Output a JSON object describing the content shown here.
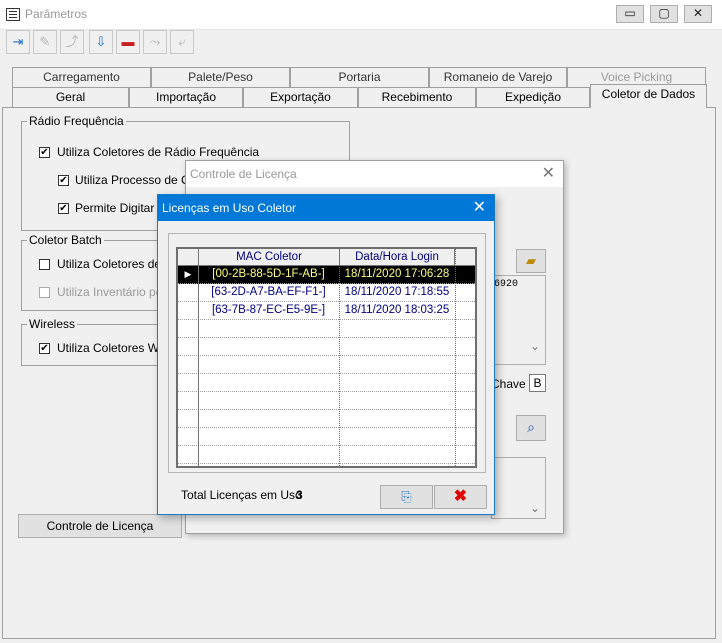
{
  "window": {
    "title": "Parâmetros",
    "controls": {
      "minimize": "▭",
      "maximize": "▢",
      "close": "✕"
    }
  },
  "toolbar": {
    "buttons": [
      {
        "icon": "exit-icon",
        "glyph": "⇥"
      },
      {
        "icon": "edit-icon",
        "glyph": "✎"
      },
      {
        "icon": "new-record-icon",
        "glyph": "⤴"
      },
      {
        "icon": "save-icon",
        "glyph": "⇩"
      },
      {
        "icon": "cancel-icon",
        "glyph": "▬"
      },
      {
        "icon": "copy-icon",
        "glyph": "⤳"
      },
      {
        "icon": "paste-icon",
        "glyph": "⤶"
      }
    ]
  },
  "tabs": {
    "back_row": [
      "Carregamento",
      "Palete/Peso",
      "Portaria",
      "Romaneio de Varejo",
      "Voice Picking"
    ],
    "front_row": [
      "Geral",
      "Importação",
      "Exportação",
      "Recebimento",
      "Expedição",
      "Coletor de Dados"
    ],
    "active": "Coletor de Dados"
  },
  "radio_freq": {
    "title": "Rádio Frequência",
    "opt1": "Utiliza Coletores de Rádio Frequência",
    "opt2": "Utiliza Processo de Con",
    "opt3": "Permite Digitar Có"
  },
  "batch": {
    "title": "Coletor Batch",
    "opt1": "Utiliza Coletores de D",
    "opt2": "Utiliza Inventário pelo"
  },
  "wireless": {
    "title": "Wireless",
    "opt1": "Utiliza Coletores Wire"
  },
  "license_button": "Controle de Licença",
  "license_dialog": {
    "title": "Controle de Licença",
    "key_fragment": "6920",
    "chave_label": "Chave",
    "chave_value": "B"
  },
  "usage_dialog": {
    "title": "Licenças em Uso Coletor",
    "columns": [
      "MAC Coletor",
      "Data/Hora Login"
    ],
    "rows": [
      {
        "mac": "[00-2B-88-5D-1F-AB-]",
        "login": "18/11/2020 17:06:28"
      },
      {
        "mac": "[63-2D-A7-BA-EF-F1-]",
        "login": "18/11/2020 17:18:55"
      },
      {
        "mac": "[63-7B-87-EC-E5-9E-]",
        "login": "18/11/2020 18:03:25"
      }
    ],
    "total_label": "Total Licenças em Uso",
    "total_value": "3"
  },
  "colors": {
    "accent": "#0078d7",
    "selected_row_bg": "#000000",
    "selected_row_text": "#ffff80",
    "row_text": "#000080",
    "cancel_red": "#e00000"
  }
}
